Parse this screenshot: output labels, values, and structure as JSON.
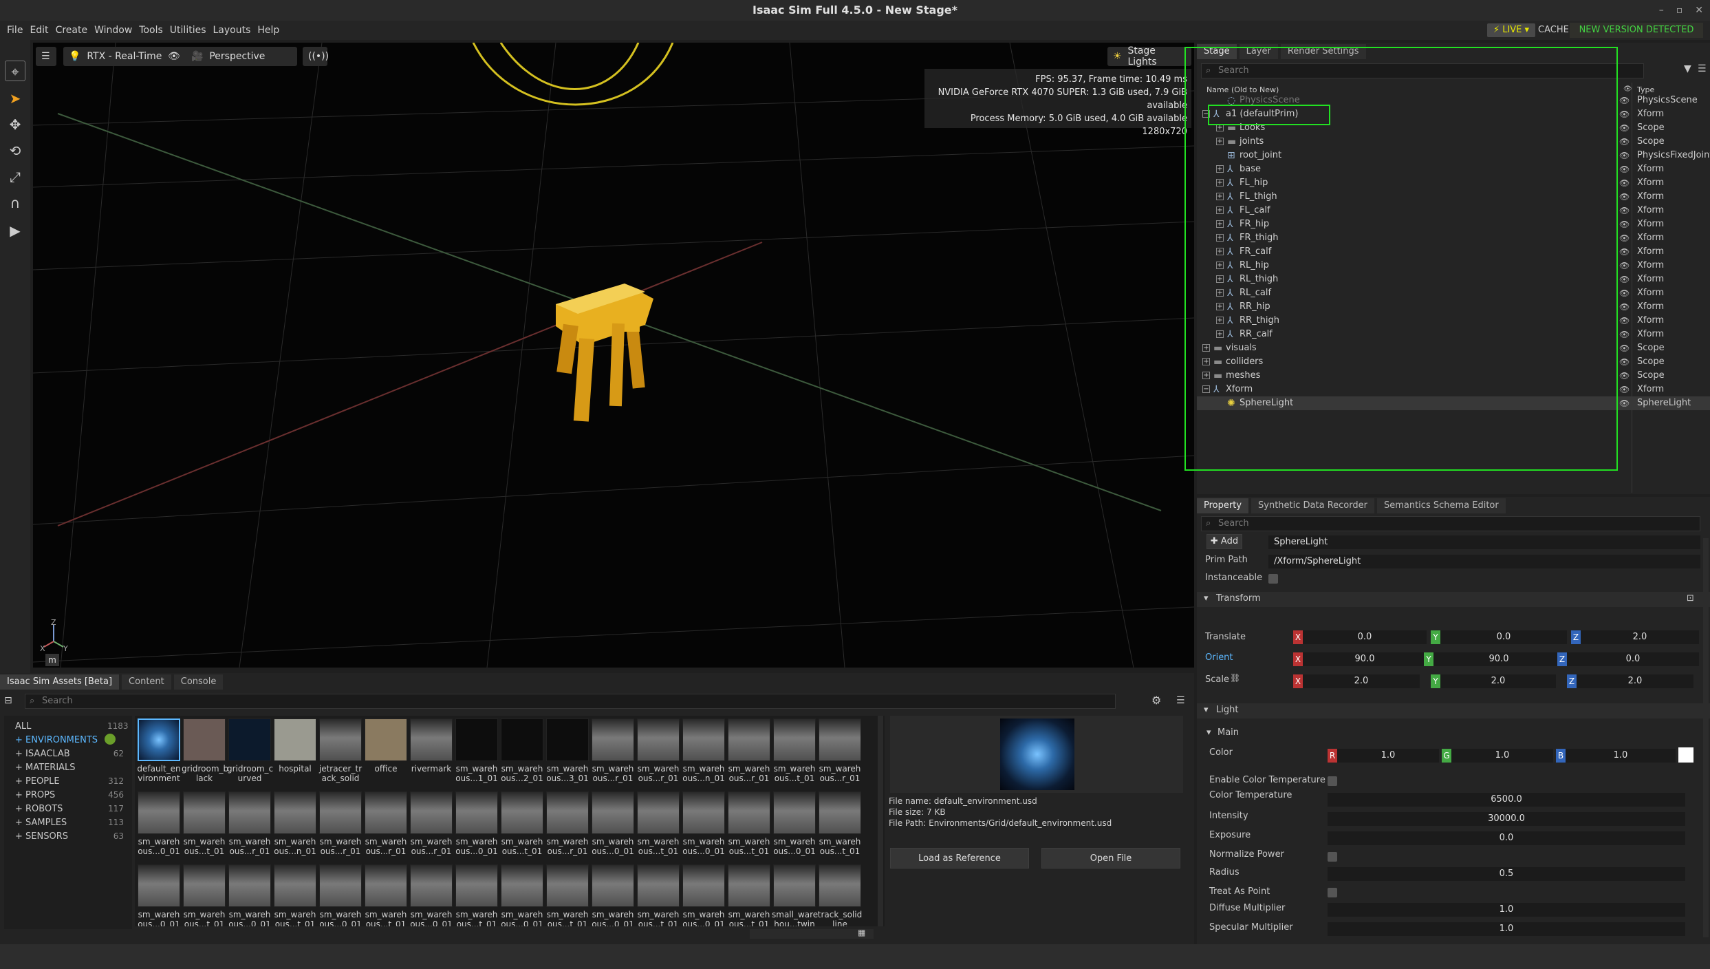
{
  "window": {
    "title": "Isaac Sim Full 4.5.0 - New Stage*",
    "minimize": "–",
    "maximize": "▫",
    "close": "✕"
  },
  "menu": [
    "File",
    "Edit",
    "Create",
    "Window",
    "Tools",
    "Utilities",
    "Layouts",
    "Help"
  ],
  "topright": {
    "live": "LIVE",
    "cache": "CACHE:",
    "version_notice": "NEW VERSION DETECTED"
  },
  "viewport": {
    "renderer": "RTX - Real-Time",
    "camera": "Perspective",
    "stage_lights": "Stage Lights",
    "stats": [
      "FPS: 95.37, Frame time: 10.49 ms",
      "NVIDIA GeForce RTX 4070 SUPER: 1.3 GiB used, 7.9 GiB available",
      "Process Memory: 5.0 GiB used, 4.0 GiB available",
      "1280x720"
    ],
    "units": "m",
    "axis_labels": {
      "z": "Z",
      "y": "Y",
      "x": "X"
    }
  },
  "bottom_tabs": [
    "Isaac Sim Assets [Beta]",
    "Content",
    "Console"
  ],
  "assets": {
    "search_placeholder": "Search",
    "categories": [
      {
        "label": "ALL",
        "count": "1183"
      },
      {
        "label": "+ ENVIRONMENTS",
        "count": ""
      },
      {
        "label": "+ ISAACLAB",
        "count": "62"
      },
      {
        "label": "+ MATERIALS",
        "count": ""
      },
      {
        "label": "+ PEOPLE",
        "count": "312"
      },
      {
        "label": "+ PROPS",
        "count": "456"
      },
      {
        "label": "+ ROBOTS",
        "count": "117"
      },
      {
        "label": "+ SAMPLES",
        "count": "113"
      },
      {
        "label": "+ SENSORS",
        "count": "63"
      }
    ],
    "row1": [
      [
        "default_en",
        "vironment"
      ],
      [
        "gridroom_b",
        "lack"
      ],
      [
        "gridroom_c",
        "urved"
      ],
      [
        "hospital",
        ""
      ],
      [
        "jetracer_tr",
        "ack_solid"
      ],
      [
        "office",
        ""
      ],
      [
        "rivermark",
        ""
      ],
      [
        "sm_wareh",
        "ous...1_01"
      ],
      [
        "sm_wareh",
        "ous...2_01"
      ],
      [
        "sm_wareh",
        "ous...3_01"
      ],
      [
        "sm_wareh",
        "ous...r_01"
      ],
      [
        "sm_wareh",
        "ous...r_01"
      ],
      [
        "sm_wareh",
        "ous...n_01"
      ],
      [
        "sm_wareh",
        "ous...r_01"
      ],
      [
        "sm_wareh",
        "ous...t_01"
      ],
      [
        "sm_wareh",
        "ous...r_01"
      ]
    ],
    "row2": [
      [
        "sm_wareh",
        "ous...0_01"
      ],
      [
        "sm_wareh",
        "ous...t_01"
      ],
      [
        "sm_wareh",
        "ous...r_01"
      ],
      [
        "sm_wareh",
        "ous...n_01"
      ],
      [
        "sm_wareh",
        "ous...r_01"
      ],
      [
        "sm_wareh",
        "ous...r_01"
      ],
      [
        "sm_wareh",
        "ous...r_01"
      ],
      [
        "sm_wareh",
        "ous...0_01"
      ],
      [
        "sm_wareh",
        "ous...t_01"
      ],
      [
        "sm_wareh",
        "ous...r_01"
      ],
      [
        "sm_wareh",
        "ous...0_01"
      ],
      [
        "sm_wareh",
        "ous...t_01"
      ],
      [
        "sm_wareh",
        "ous...0_01"
      ],
      [
        "sm_wareh",
        "ous...t_01"
      ],
      [
        "sm_wareh",
        "ous...0_01"
      ],
      [
        "sm_wareh",
        "ous...t_01"
      ]
    ],
    "row3": [
      [
        "sm_wareh",
        "ous...0_01"
      ],
      [
        "sm_wareh",
        "ous...t_01"
      ],
      [
        "sm_wareh",
        "ous...0_01"
      ],
      [
        "sm_wareh",
        "ous...t_01"
      ],
      [
        "sm_wareh",
        "ous...0_01"
      ],
      [
        "sm_wareh",
        "ous...t_01"
      ],
      [
        "sm_wareh",
        "ous...0_01"
      ],
      [
        "sm_wareh",
        "ous...t_01"
      ],
      [
        "sm_wareh",
        "ous...0_01"
      ],
      [
        "sm_wareh",
        "ous...t_01"
      ],
      [
        "sm_wareh",
        "ous...0_01"
      ],
      [
        "sm_wareh",
        "ous...t_01"
      ],
      [
        "sm_wareh",
        "ous...0_01"
      ],
      [
        "sm_wareh",
        "ous...t_01"
      ],
      [
        "small_ware",
        "hou...twin"
      ],
      [
        "track_solid",
        "line"
      ]
    ],
    "preview": {
      "file_name": "File name: default_environment.usd",
      "file_size": "File size: 7 KB",
      "file_path": "File Path: Environments/Grid/default_environment.usd",
      "load_ref": "Load as Reference",
      "open_file": "Open File"
    }
  },
  "stage": {
    "tabs": [
      "Stage",
      "Layer",
      "Render Settings"
    ],
    "search_placeholder": "Search",
    "col_name": "Name (Old to New)",
    "col_type": "Type",
    "rows": [
      {
        "name": "PhysicsScene",
        "type": "PhysicsScene",
        "indent": 1,
        "exp": "",
        "kind": "phys"
      },
      {
        "name": "a1 (defaultPrim)",
        "type": "Xform",
        "indent": 0,
        "exp": "−",
        "kind": "xform"
      },
      {
        "name": "Looks",
        "type": "Scope",
        "indent": 1,
        "exp": "+",
        "kind": "folder"
      },
      {
        "name": "joints",
        "type": "Scope",
        "indent": 1,
        "exp": "+",
        "kind": "folder"
      },
      {
        "name": "root_joint",
        "type": "PhysicsFixedJoint",
        "indent": 1,
        "exp": "",
        "kind": "joint"
      },
      {
        "name": "base",
        "type": "Xform",
        "indent": 1,
        "exp": "+",
        "kind": "xform"
      },
      {
        "name": "FL_hip",
        "type": "Xform",
        "indent": 1,
        "exp": "+",
        "kind": "xform"
      },
      {
        "name": "FL_thigh",
        "type": "Xform",
        "indent": 1,
        "exp": "+",
        "kind": "xform"
      },
      {
        "name": "FL_calf",
        "type": "Xform",
        "indent": 1,
        "exp": "+",
        "kind": "xform"
      },
      {
        "name": "FR_hip",
        "type": "Xform",
        "indent": 1,
        "exp": "+",
        "kind": "xform"
      },
      {
        "name": "FR_thigh",
        "type": "Xform",
        "indent": 1,
        "exp": "+",
        "kind": "xform"
      },
      {
        "name": "FR_calf",
        "type": "Xform",
        "indent": 1,
        "exp": "+",
        "kind": "xform"
      },
      {
        "name": "RL_hip",
        "type": "Xform",
        "indent": 1,
        "exp": "+",
        "kind": "xform"
      },
      {
        "name": "RL_thigh",
        "type": "Xform",
        "indent": 1,
        "exp": "+",
        "kind": "xform"
      },
      {
        "name": "RL_calf",
        "type": "Xform",
        "indent": 1,
        "exp": "+",
        "kind": "xform"
      },
      {
        "name": "RR_hip",
        "type": "Xform",
        "indent": 1,
        "exp": "+",
        "kind": "xform"
      },
      {
        "name": "RR_thigh",
        "type": "Xform",
        "indent": 1,
        "exp": "+",
        "kind": "xform"
      },
      {
        "name": "RR_calf",
        "type": "Xform",
        "indent": 1,
        "exp": "+",
        "kind": "xform"
      },
      {
        "name": "visuals",
        "type": "Scope",
        "indent": 0,
        "exp": "+",
        "kind": "folder"
      },
      {
        "name": "colliders",
        "type": "Scope",
        "indent": 0,
        "exp": "+",
        "kind": "folder"
      },
      {
        "name": "meshes",
        "type": "Scope",
        "indent": 0,
        "exp": "+",
        "kind": "folder"
      },
      {
        "name": "Xform",
        "type": "Xform",
        "indent": 0,
        "exp": "−",
        "kind": "xform"
      },
      {
        "name": "SphereLight",
        "type": "SphereLight",
        "indent": 1,
        "exp": "",
        "kind": "light"
      }
    ]
  },
  "property": {
    "tabs": [
      "Property",
      "Synthetic Data Recorder",
      "Semantics Schema Editor"
    ],
    "search_placeholder": "Search",
    "add": "Add",
    "prim_name": "SphereLight",
    "prim_path_label": "Prim Path",
    "prim_path": "/Xform/SphereLight",
    "instanceable": "Instanceable",
    "transform": "Transform",
    "translate_label": "Translate",
    "orient_label": "Orient",
    "scale_label": "Scale",
    "translate": [
      "0.0",
      "0.0",
      "2.0"
    ],
    "orient": [
      "90.0",
      "90.0",
      "0.0"
    ],
    "scale": [
      "2.0",
      "2.0",
      "2.0"
    ],
    "light": "Light",
    "main": "Main",
    "color_label": "Color",
    "color": [
      "1.0",
      "1.0",
      "1.0"
    ],
    "enable_color_temp": "Enable Color Temperature",
    "color_temp_label": "Color Temperature",
    "color_temp": "6500.0",
    "intensity_label": "Intensity",
    "intensity": "30000.0",
    "exposure_label": "Exposure",
    "exposure": "0.0",
    "normalize_label": "Normalize Power",
    "radius_label": "Radius",
    "radius": "0.5",
    "treat_point_label": "Treat As Point",
    "diffuse_label": "Diffuse Multiplier",
    "diffuse": "1.0",
    "specular_label": "Specular Multiplier",
    "specular": "1.0"
  },
  "colors": {
    "accent_green": "#22e022",
    "live_yellow": "#e8e800",
    "robot_gold": "#e8b020"
  }
}
